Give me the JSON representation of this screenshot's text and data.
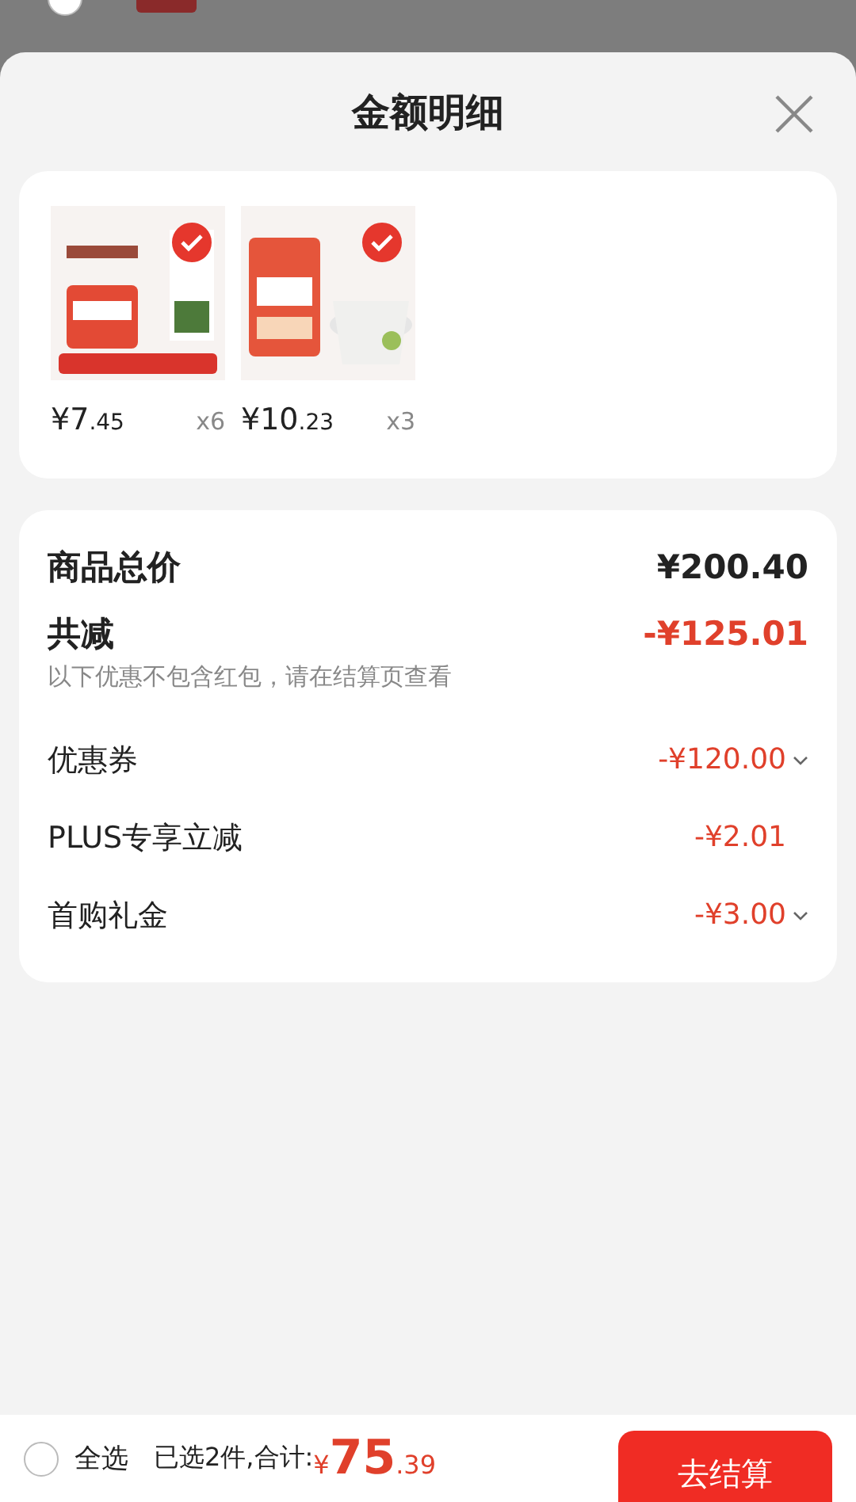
{
  "store": {
    "checked": false
  },
  "sheet": {
    "title": "金额明细"
  },
  "products": [
    {
      "price_int": "¥7",
      "price_dec": ".45",
      "qty": "x6",
      "selected": true
    },
    {
      "price_int": "¥10",
      "price_dec": ".23",
      "qty": "x3",
      "selected": true
    }
  ],
  "summary": {
    "total_label": "商品总价",
    "total_value": "¥200.40",
    "discount_label": "共减",
    "discount_value": "-¥125.01",
    "note": "以下优惠不包含红包，请在结算页查看",
    "items": [
      {
        "label": "优惠券",
        "value": "-¥120.00",
        "expandable": true
      },
      {
        "label": "PLUS专享立减",
        "value": "-¥2.01",
        "expandable": false
      },
      {
        "label": "首购礼金",
        "value": "-¥3.00",
        "expandable": true
      }
    ]
  },
  "footer": {
    "select_all": "全选",
    "select_all_checked": false,
    "count_text": "已选2件,合计:",
    "currency": "¥",
    "amount_int": "75",
    "amount_dec": ".39",
    "checkout": "去结算"
  }
}
